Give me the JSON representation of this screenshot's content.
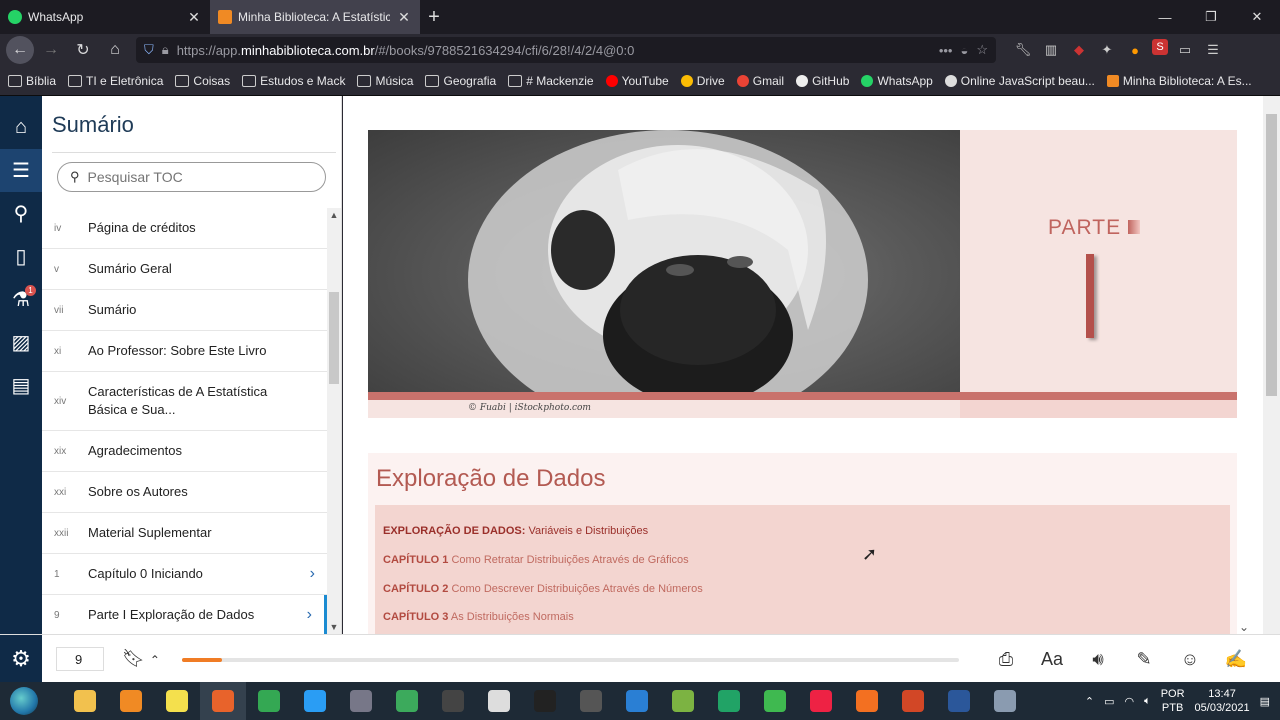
{
  "browser": {
    "tabs": [
      {
        "title": "WhatsApp",
        "color": "#25d366",
        "active": false
      },
      {
        "title": "Minha Biblioteca: A Estatística",
        "color": "#f08a24",
        "active": true
      }
    ],
    "url_prefix": "https://app.",
    "url_domain": "minhabiblioteca.com.br",
    "url_rest": "/#/books/9788521634294/cfi/6/28!/4/2/4@0:0",
    "bookmarks": [
      "Bíblia",
      "TI e Eletrônica",
      "Coisas",
      "Estudos e Mack",
      "Música",
      "Geografia",
      "# Mackenzie",
      "YouTube",
      "Drive",
      "Gmail",
      "GitHub",
      "WhatsApp",
      "Online JavaScript beau...",
      "Minha Biblioteca: A Es..."
    ]
  },
  "rail": {
    "icons": [
      "home-icon",
      "toc-icon",
      "search-icon",
      "notebook-icon",
      "flask-icon",
      "image-icon",
      "cards-icon"
    ],
    "badge": "1"
  },
  "toc": {
    "title": "Sumário",
    "search_placeholder": "Pesquisar TOC",
    "items": [
      {
        "page": "iv",
        "label": "Página de créditos"
      },
      {
        "page": "v",
        "label": "Sumário Geral"
      },
      {
        "page": "vii",
        "label": "Sumário"
      },
      {
        "page": "xi",
        "label": "Ao Professor: Sobre Este Livro"
      },
      {
        "page": "xiv",
        "label": "Características de A Estatística Básica e Sua..."
      },
      {
        "page": "xix",
        "label": "Agradecimentos"
      },
      {
        "page": "xxi",
        "label": "Sobre os Autores"
      },
      {
        "page": "xxii",
        "label": "Material Suplementar"
      },
      {
        "page": "1",
        "label": "Capítulo 0 Iniciando"
      },
      {
        "page": "9",
        "label": "Parte I Exploração de Dados"
      }
    ]
  },
  "book": {
    "parte_label": "PARTE",
    "photo_credit": "© Fuabi | iStockphoto.com",
    "section_title": "Exploração de Dados",
    "contents": [
      {
        "bold": "EXPLORAÇÃO DE DADOS:",
        "text": " Variáveis e Distribuições"
      },
      {
        "bold": "CAPÍTULO 1",
        "text": " Como Retratar Distribuições Através de Gráficos"
      },
      {
        "bold": "CAPÍTULO 2",
        "text": " Como Descrever Distribuições Através de Números"
      },
      {
        "bold": "CAPÍTULO 3",
        "text": " As Distribuições Normais"
      }
    ]
  },
  "footer": {
    "page_number": "9",
    "progress_fraction": 0.052,
    "tools": [
      "print-icon",
      "font-size-icon",
      "audio-icon",
      "highlight-icon",
      "feedback-icon",
      "notes-icon"
    ],
    "font_label": "Aa"
  },
  "taskbar": {
    "icons": [
      {
        "name": "file-explorer-icon",
        "color": "#f2c14e"
      },
      {
        "name": "app-orange-icon",
        "color": "#f08a24"
      },
      {
        "name": "sticky-notes-icon",
        "color": "#f4e04d"
      },
      {
        "name": "firefox-icon",
        "color": "#e8632b",
        "active": true
      },
      {
        "name": "chrome-icon",
        "color": "#34a853"
      },
      {
        "name": "app-blue-icon",
        "color": "#2a9df4"
      },
      {
        "name": "app-gray-icon",
        "color": "#778"
      },
      {
        "name": "app-green-icon",
        "color": "#3caa5c"
      },
      {
        "name": "app-dark-icon",
        "color": "#444"
      },
      {
        "name": "app-box-icon",
        "color": "#ddd"
      },
      {
        "name": "unity-icon",
        "color": "#222"
      },
      {
        "name": "app-chip-icon",
        "color": "#555"
      },
      {
        "name": "vscode-icon",
        "color": "#2a7fd4"
      },
      {
        "name": "app-android-icon",
        "color": "#7cb342"
      },
      {
        "name": "excel-icon",
        "color": "#21a366"
      },
      {
        "name": "app-ring-icon",
        "color": "#3fb950"
      },
      {
        "name": "app-web-icon",
        "color": "#e24"
      },
      {
        "name": "app-swirl-icon",
        "color": "#f37021"
      },
      {
        "name": "powerpoint-icon",
        "color": "#d24726"
      },
      {
        "name": "word-icon",
        "color": "#2b579a"
      },
      {
        "name": "app-steam-icon",
        "color": "#8a9bb0"
      }
    ],
    "lang": "POR",
    "layout": "PTB",
    "time": "13:47",
    "date": "05/03/2021"
  }
}
